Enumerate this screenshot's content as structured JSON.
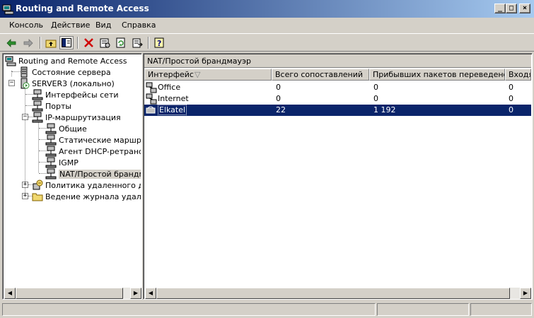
{
  "window": {
    "title": "Routing and Remote Access"
  },
  "menu": [
    {
      "label": "Консоль"
    },
    {
      "label": "Действие"
    },
    {
      "label": "Вид"
    },
    {
      "label": "Справка"
    }
  ],
  "tree": {
    "root": "Routing and Remote Access",
    "status": "Состояние сервера",
    "server": "SERVER3 (локально)",
    "interfaces": "Интерфейсы сети",
    "ports": "Порты",
    "ip": "IP-маршрутизация",
    "general": "Общие",
    "static": "Статические маршруты",
    "dhcp": "Агент DHCP-ретрансляции",
    "igmp": "IGMP",
    "nat": "NAT/Простой брандмауэр",
    "policy": "Политика удаленного доступа",
    "logging": "Ведение журнала удаленного доступа"
  },
  "list": {
    "caption": "NAT/Простой брандмауэр",
    "columns": [
      "Интерфейс",
      "Всего сопоставлений",
      "Прибывших пакетов переведено",
      "Входящих пакетов отброшено"
    ],
    "rows": [
      {
        "name": "Office",
        "total": "0",
        "translated": "0",
        "rejected": "0",
        "selected": false
      },
      {
        "name": "Internet",
        "total": "0",
        "translated": "0",
        "rejected": "0",
        "selected": false
      },
      {
        "name": "Elkatel",
        "total": "22",
        "translated": "1 192",
        "rejected": "0",
        "selected": true
      }
    ]
  },
  "colors": {
    "title_start": "#0a246a",
    "title_end": "#a6caf0",
    "selection": "#0a246a",
    "chrome": "#d4d0c8"
  }
}
